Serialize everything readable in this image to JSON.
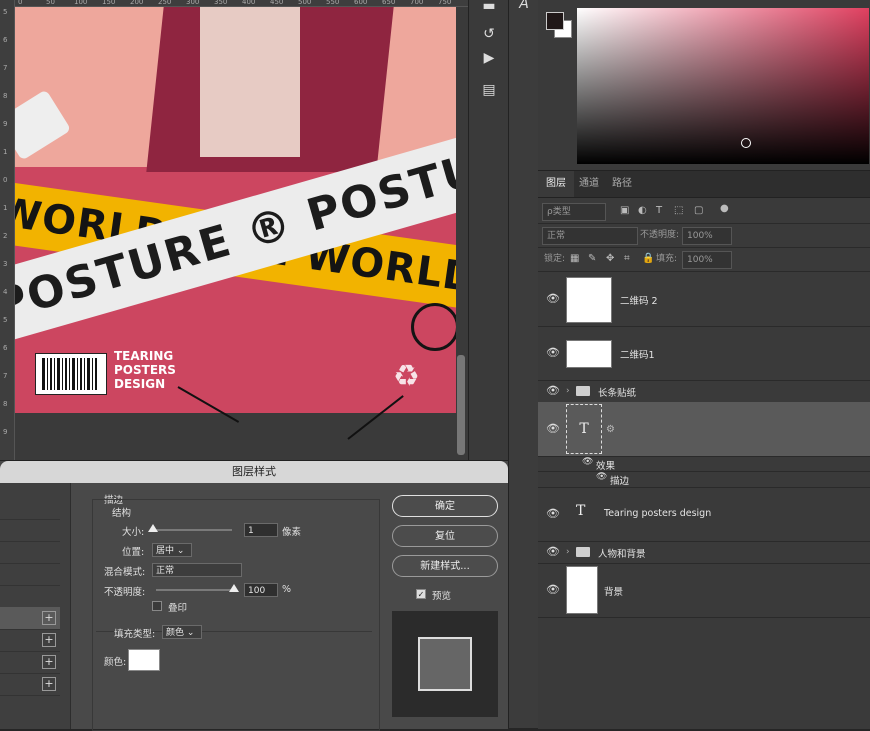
{
  "canvas": {
    "tape_white_text": "POSTURE ® POSTURE",
    "tape_yellow_text": "WORLDWIDE WORLDWIDE",
    "poster_text": [
      "TEARING",
      "POSTERS",
      "DESIGN"
    ],
    "ruler_numbers": [
      "0",
      "50",
      "100",
      "150",
      "200",
      "250",
      "300",
      "350",
      "400",
      "450",
      "500",
      "550",
      "600",
      "650",
      "700",
      "750"
    ],
    "left_ruler_numbers": [
      "5",
      "6",
      "7",
      "8",
      "9",
      "1",
      "0",
      "1",
      "2",
      "3",
      "4",
      "5",
      "6",
      "7",
      "8",
      "9"
    ]
  },
  "tools": {
    "type_tool_glyph": "A"
  },
  "layers_panel": {
    "tabs": [
      "图层",
      "通道",
      "路径"
    ],
    "filter_kind": "ρ类型",
    "blend_mode": "正常",
    "opacity_label": "不透明度:",
    "opacity_value": "100%",
    "lock_label": "锁定:",
    "fill_label": "填充:",
    "fill_value": "100%",
    "layers": [
      {
        "name": "二维码 2",
        "type": "image"
      },
      {
        "name": "二维码1",
        "type": "barcode"
      },
      {
        "name": "长条贴纸",
        "type": "group"
      },
      {
        "name": "",
        "type": "text-selected"
      },
      {
        "name": "Tearing  posters design",
        "type": "text"
      },
      {
        "name": "人物和背景",
        "type": "group"
      },
      {
        "name": "背景",
        "type": "fill"
      }
    ],
    "effects_label": "效果",
    "stroke_effect_label": "描边"
  },
  "dialog": {
    "title": "图层样式",
    "section_title": "描边",
    "structure_title": "结构",
    "size_label": "大小:",
    "size_value": "1",
    "size_unit": "像素",
    "position_label": "位置:",
    "position_value": "居中",
    "blend_label": "混合模式:",
    "blend_value": "正常",
    "opacity_label": "不透明度:",
    "opacity_value": "100",
    "opacity_unit": "%",
    "overprint_label": "叠印",
    "fill_type_label": "填充类型:",
    "fill_type_value": "颜色",
    "color_label": "颜色:",
    "buttons": {
      "ok": "确定",
      "reset": "复位",
      "new_style": "新建样式...",
      "preview": "预览"
    },
    "preview_checked": true
  }
}
